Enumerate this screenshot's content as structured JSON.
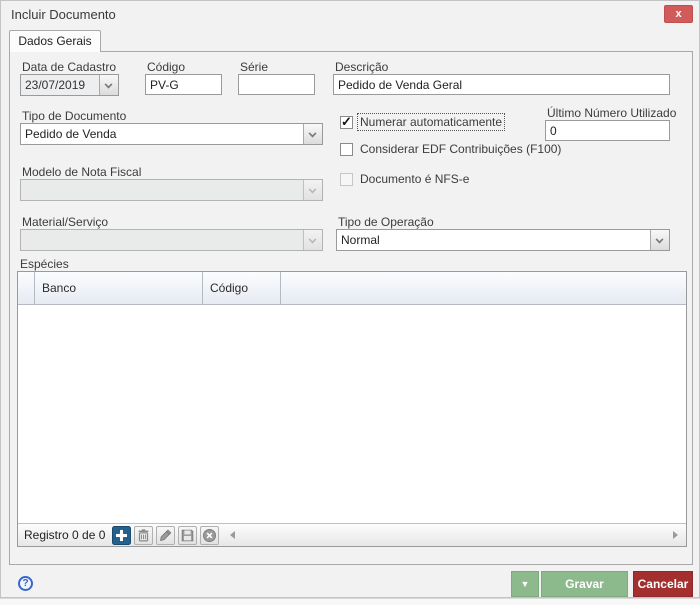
{
  "window": {
    "title": "Incluir Documento",
    "close_label": "x"
  },
  "tabs": {
    "dados_gerais": "Dados Gerais"
  },
  "form": {
    "data_cadastro": {
      "label": "Data de Cadastro",
      "value": "23/07/2019"
    },
    "codigo": {
      "label": "Código",
      "value": "PV-G"
    },
    "serie": {
      "label": "Série",
      "value": ""
    },
    "descricao": {
      "label": "Descrição",
      "value": "Pedido de Venda Geral"
    },
    "tipo_documento": {
      "label": "Tipo de Documento",
      "value": "Pedido de Venda"
    },
    "numerar": {
      "label": "Numerar automaticamente",
      "checked": true
    },
    "ultimo_numero": {
      "label": "Último Número Utilizado",
      "value": "0"
    },
    "edf": {
      "label": "Considerar EDF Contribuições (F100)",
      "checked": false
    },
    "nfse": {
      "label": "Documento é NFS-e",
      "checked": false
    },
    "modelo_nf": {
      "label": "Modelo de Nota Fiscal",
      "value": ""
    },
    "material_servico": {
      "label": "Material/Serviço",
      "value": ""
    },
    "tipo_operacao": {
      "label": "Tipo de Operação",
      "value": "Normal"
    }
  },
  "especies": {
    "title": "Espécies",
    "columns": {
      "banco": "Banco",
      "codigo": "Código"
    },
    "rows": [],
    "status": "Registro 0 de 0"
  },
  "footer": {
    "help_label": "?",
    "dropdown_label": "▼",
    "gravar_label": "Gravar",
    "cancelar_label": "Cancelar"
  },
  "colors": {
    "save_green": "#8cba8c",
    "cancel_red": "#a42f2f",
    "close_red": "#d15b5b",
    "add_blue": "#24618e",
    "help_blue": "#3a66c8",
    "grid_header": "#e6ebf2"
  }
}
